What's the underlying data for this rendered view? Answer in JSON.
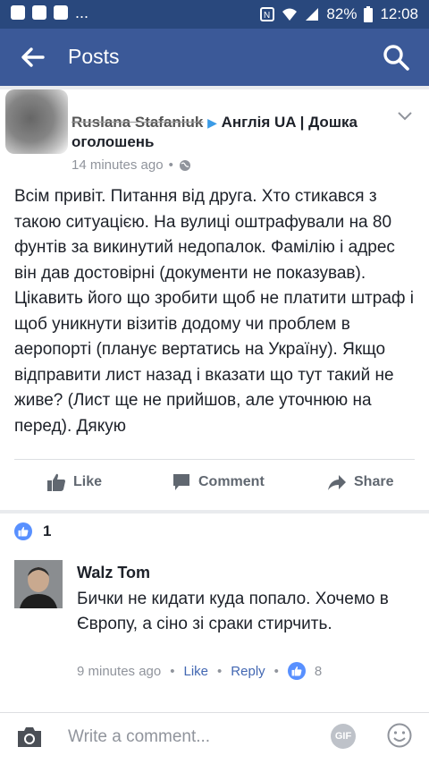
{
  "status_bar": {
    "time": "12:08",
    "battery": "82%",
    "icons": [
      "sms-icon",
      "facebook-icon",
      "youtube-icon",
      "more-dots-icon",
      "nfc-icon",
      "wifi-icon",
      "signal-icon",
      "battery-icon"
    ],
    "dots": "..."
  },
  "navbar": {
    "title": "Posts",
    "back_icon": "back-arrow-icon",
    "search_icon": "search-icon"
  },
  "post": {
    "author_name": "Ruslana Stafaniuk",
    "group_name": "Англія UA | Дошка оголошень",
    "time": "14 minutes ago",
    "privacy_icon": "globe-icon",
    "text": "Всім привіт. Питання від друга. Хто стикався з такою ситуацією.  На вулиці оштрафували на 80 фунтів за викинутий недопалок. Фамілію і адрес він дав достовірні (документи не показував). Цікавить його що зробити щоб не платити штраф і щоб уникнути візитів додому чи проблем в аеропорті (планує вертатись на Україну). Якщо відправити лист назад і вказати що тут такий не живе? (Лист ще не прийшов, але уточнюю на перед). Дякую",
    "actions": {
      "like": "Like",
      "comment": "Comment",
      "share": "Share"
    }
  },
  "reactions": {
    "count": "1"
  },
  "comment": {
    "author": "Walz Tom",
    "text": "Бички не кидати куда попало. Хочемо в Європу, а сіно зі сраки стирчить.",
    "time": "9 minutes ago",
    "like_label": "Like",
    "reply_label": "Reply",
    "like_count": "8"
  },
  "composer": {
    "placeholder": "Write a comment...",
    "gif_label": "GIF"
  },
  "colors": {
    "nav": "#3b5998",
    "status": "#29487d",
    "link": "#4267b2",
    "like_blue": "#5890ff"
  }
}
